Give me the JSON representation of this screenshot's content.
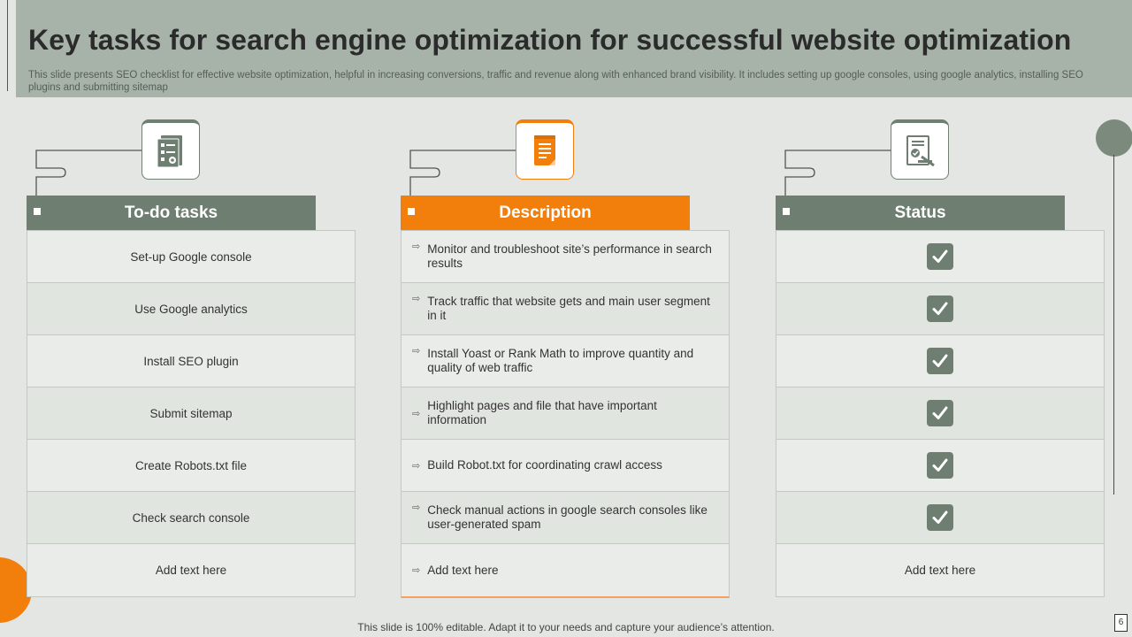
{
  "slide": {
    "title": "Key tasks for search engine optimization for successful website optimization",
    "subtitle": "This slide presents SEO checklist for effective website optimization, helpful in increasing conversions, traffic and revenue along with enhanced brand visibility. It includes setting up google consoles, using google analytics, installing SEO plugins and submitting sitemap",
    "footer": "This slide is 100% editable. Adapt it to your needs and capture your audience’s attention.",
    "page_number": "6"
  },
  "colors": {
    "accent_green": "#6e7f72",
    "accent_orange": "#f27f0c",
    "header_band": "#a7b3a9"
  },
  "columns": {
    "todo": {
      "header": "To-do tasks",
      "icon": "checklist-document-icon",
      "rows": [
        "Set-up Google console",
        "Use Google  analytics",
        "Install SEO plugin",
        "Submit sitemap",
        "Create Robots.txt file",
        "Check search console",
        "Add text here"
      ]
    },
    "description": {
      "header": "Description",
      "icon": "document-icon",
      "bullet": "⇨",
      "rows": [
        "Monitor and troubleshoot site’s performance  in search results",
        "Track traffic that website gets and main user segment  in it",
        "Install Yoast or Rank Math to improve  quantity and quality of web traffic",
        "Highlight pages and file that have important information",
        "Build Robot.txt for coordinating crawl access",
        "Check manual actions in google search consoles like user-generated  spam",
        "Add text here"
      ]
    },
    "status": {
      "header": "Status",
      "icon": "approved-document-icon",
      "check_icon": "checkmark-icon",
      "last_row": "Add text here"
    }
  }
}
